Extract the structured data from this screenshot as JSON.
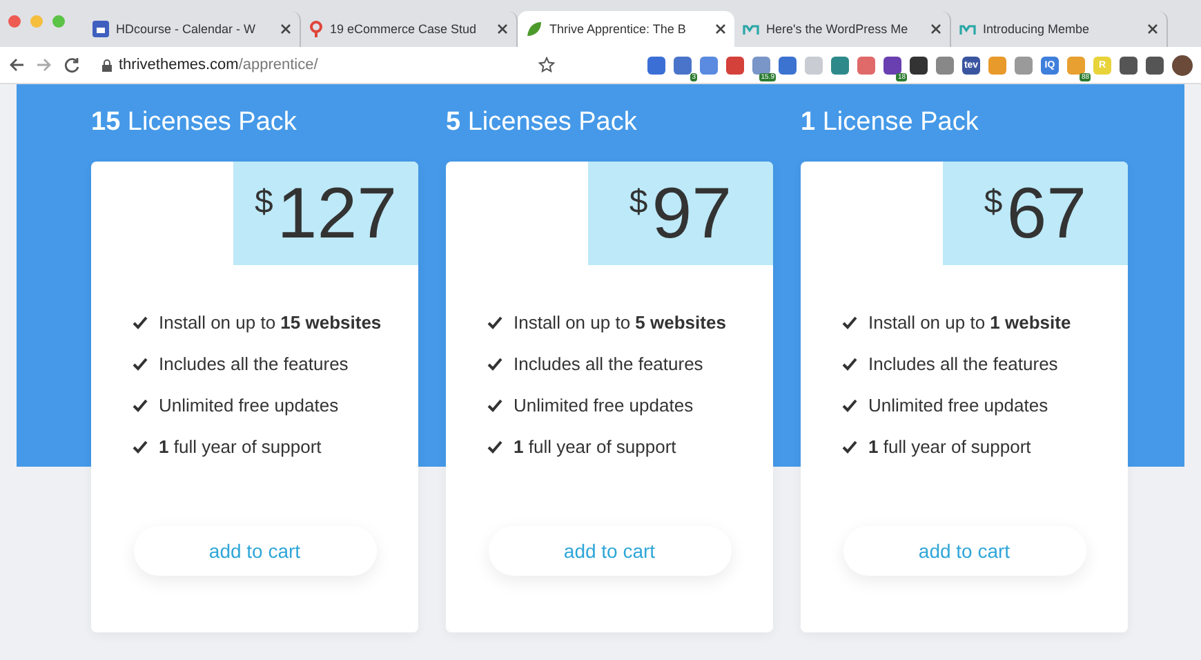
{
  "tabs": [
    {
      "label": "HDcourse - Calendar - W",
      "selected": false
    },
    {
      "label": "19 eCommerce Case Stud",
      "selected": false
    },
    {
      "label": "Thrive Apprentice: The B",
      "selected": true
    },
    {
      "label": "Here's the WordPress Me",
      "selected": false
    },
    {
      "label": "Introducing Membe",
      "selected": false
    }
  ],
  "address": {
    "domain": "thrivethemes.com",
    "path": "/apprentice/"
  },
  "extensions": [
    {
      "color": "#3b6fd6"
    },
    {
      "color": "#4a74c9",
      "badge": "3"
    },
    {
      "color": "#5a8be0"
    },
    {
      "color": "#d4403a"
    },
    {
      "color": "#7a96c8",
      "badge": "15.9"
    },
    {
      "color": "#3d73d0"
    },
    {
      "color": "#c9ccd2"
    },
    {
      "color": "#2e8a8a"
    },
    {
      "color": "#e06a6a"
    },
    {
      "color": "#6a3fb0",
      "badge": "18"
    },
    {
      "color": "#333333"
    },
    {
      "color": "#888888"
    },
    {
      "color": "#3a55a0",
      "label": "tev"
    },
    {
      "color": "#e89a2a"
    },
    {
      "color": "#9a9a9a"
    },
    {
      "color": "#3f7fdc",
      "label": "IQ"
    },
    {
      "color": "#e8a030",
      "badge": "88"
    },
    {
      "color": "#e8d33a",
      "label": "R"
    },
    {
      "color": "#555555"
    },
    {
      "color": "#555555"
    }
  ],
  "packs": [
    {
      "count": "15",
      "title": "Licenses Pack",
      "currency": "$",
      "price": "127",
      "features": [
        "Install on up to **15 websites**",
        "Includes all the features",
        "Unlimited free updates",
        "**1** full year of support"
      ],
      "button": "add to cart"
    },
    {
      "count": "5",
      "title": "Licenses Pack",
      "currency": "$",
      "price": "97",
      "features": [
        "Install on up to **5 websites**",
        "Includes all the features",
        "Unlimited free updates",
        "**1** full year of support"
      ],
      "button": "add to cart"
    },
    {
      "count": "1",
      "title": "License Pack",
      "currency": "$",
      "price": "67",
      "features": [
        "Install on up to **1 website**",
        "Includes all the features",
        "Unlimited free updates",
        "**1** full year of support"
      ],
      "button": "add to cart"
    }
  ]
}
